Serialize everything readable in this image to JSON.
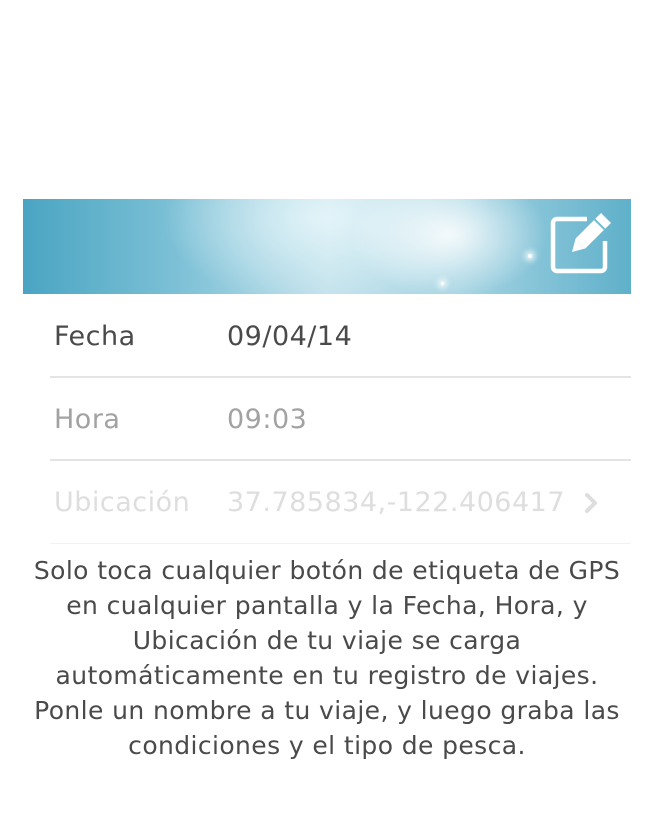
{
  "header": {
    "edit_icon": "edit-icon",
    "accent_color": "#5eb3cf"
  },
  "rows": [
    {
      "label": "Fecha",
      "value": "09/04/14"
    },
    {
      "label": "Hora",
      "value": "09:03"
    },
    {
      "label": "Ubicación",
      "value": "37.785834,-122.406417",
      "chevron_icon": "chevron-right-icon"
    }
  ],
  "description": "Solo toca cualquier botón de etiqueta de GPS en cualquier pantalla y la Fecha, Hora, y Ubicación de tu viaje se carga automáticamente en tu registro de viajes. Ponle un nombre a tu viaje, y luego graba las condiciones y el tipo de pesca."
}
